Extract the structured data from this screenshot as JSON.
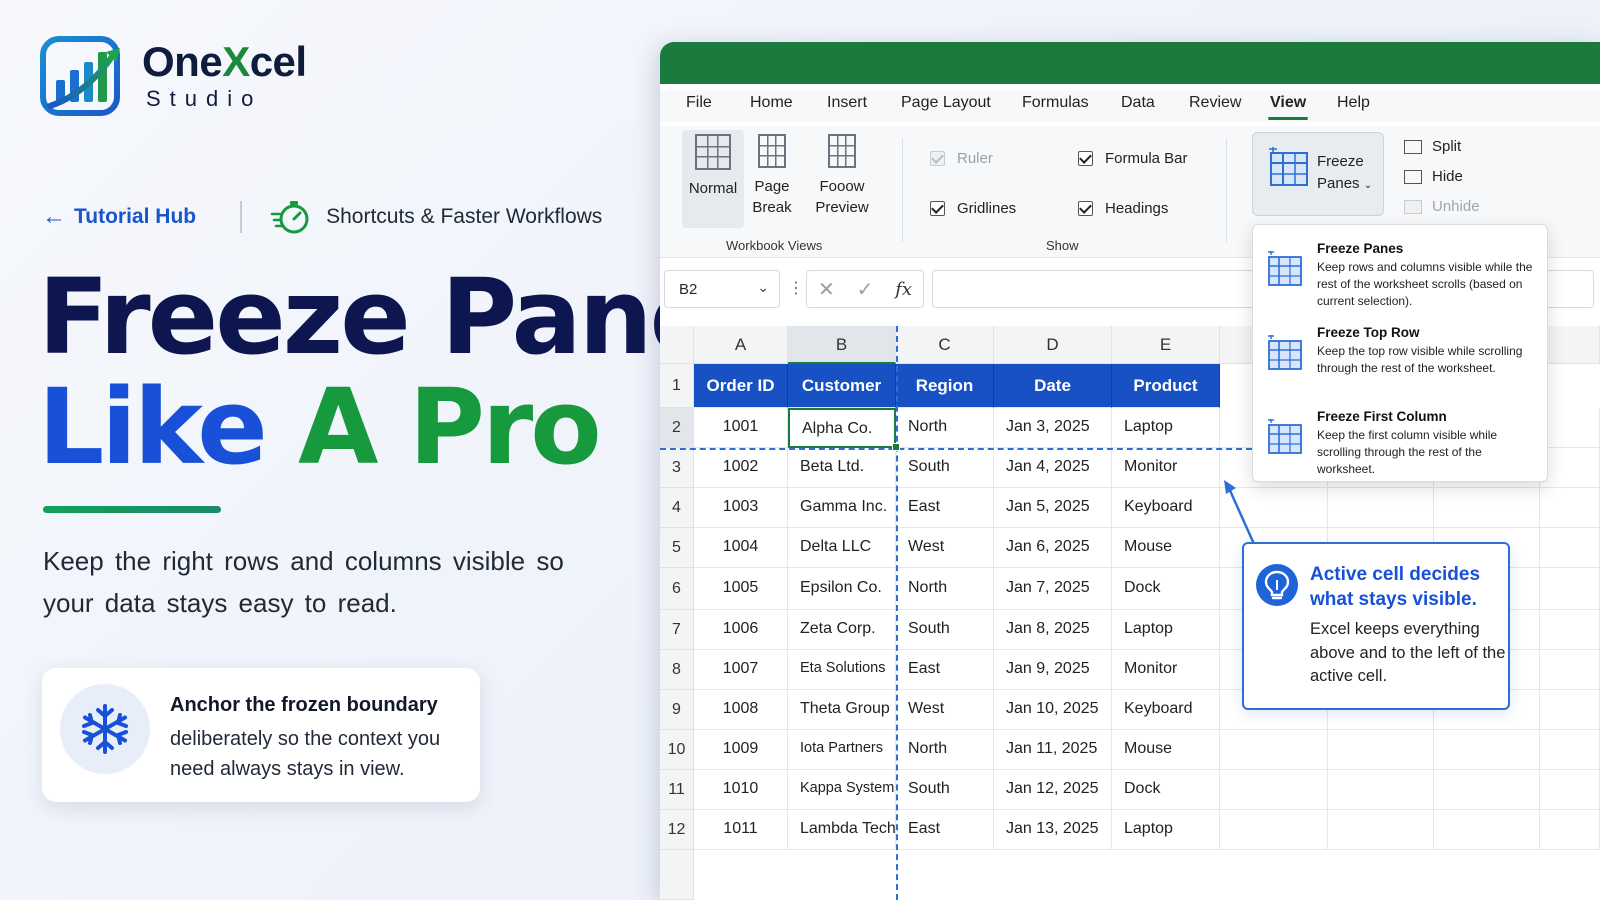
{
  "brand": {
    "name_part1": "One",
    "name_x": "X",
    "name_part2": "cel",
    "sub": "Studio"
  },
  "nav": {
    "back_label": "Tutorial Hub",
    "section": "Shortcuts & Faster Workflows"
  },
  "hero": {
    "line1": "Freeze Panes",
    "line2_a": "Like",
    "line2_b": "A Pro"
  },
  "tagline": "Keep the right rows and columns visible so your data stays easy to read.",
  "tip": {
    "title": "Anchor the frozen boundary",
    "body": "deliberately so the context you need always stays in view."
  },
  "excel": {
    "tabs": [
      "File",
      "Home",
      "Insert",
      "Page Layout",
      "Formulas",
      "Data",
      "Review",
      "View",
      "Help"
    ],
    "active_tab": "View",
    "workbook_views": {
      "normal": "Normal",
      "page_break_1": "Page",
      "page_break_2": "Break",
      "page_layout_1": "Fooow",
      "page_layout_2": "Preview",
      "group_label": "Workbook Views"
    },
    "show": {
      "ruler": "Ruler",
      "gridlines": "Gridlines",
      "formula_bar": "Formula Bar",
      "headings": "Headings",
      "group_label": "Show"
    },
    "freeze_button": {
      "line1": "Freeze",
      "line2": "Panes"
    },
    "window": {
      "split": "Split",
      "hide": "Hide",
      "unhide": "Unhide"
    },
    "name_box": "B2",
    "col_letters": [
      "A",
      "B",
      "C",
      "D",
      "E"
    ],
    "headers": [
      "Order ID",
      "Customer",
      "Region",
      "Date",
      "Product"
    ],
    "rows": [
      [
        "1001",
        "Alpha Co.",
        "North",
        "Jan 3, 2025",
        "Laptop"
      ],
      [
        "1002",
        "Beta Ltd.",
        "South",
        "Jan 4, 2025",
        "Monitor"
      ],
      [
        "1003",
        "Gamma Inc.",
        "East",
        "Jan 5, 2025",
        "Keyboard"
      ],
      [
        "1004",
        "Delta LLC",
        "West",
        "Jan 6, 2025",
        "Mouse"
      ],
      [
        "1005",
        "Epsilon Co.",
        "North",
        "Jan 7, 2025",
        "Dock"
      ],
      [
        "1006",
        "Zeta Corp.",
        "South",
        "Jan 8, 2025",
        "Laptop"
      ],
      [
        "1007",
        "Eta Solutions",
        "East",
        "Jan 9, 2025",
        "Monitor"
      ],
      [
        "1008",
        "Theta Group",
        "West",
        "Jan 10, 2025",
        "Keyboard"
      ],
      [
        "1009",
        "Iota Partners",
        "North",
        "Jan 11, 2025",
        "Mouse"
      ],
      [
        "1010",
        "Kappa Systems",
        "South",
        "Jan 12, 2025",
        "Dock"
      ],
      [
        "1011",
        "Lambda Tech",
        "East",
        "Jan 13, 2025",
        "Laptop"
      ]
    ],
    "menu": [
      {
        "title": "Freeze Panes",
        "desc": "Keep rows and columns visible while the rest of the worksheet scrolls (based on current selection)."
      },
      {
        "title": "Freeze Top Row",
        "desc": "Keep the top row visible while scrolling through the rest of the worksheet."
      },
      {
        "title": "Freeze First Column",
        "desc": "Keep the first column visible while scrolling through the rest of the worksheet."
      }
    ],
    "callout": {
      "title": "Active cell decides what stays visible.",
      "body": "Excel keeps everything above and to the left of the active cell."
    }
  },
  "colors": {
    "excel_green": "#1b7a3e",
    "header_blue": "#1751c4",
    "hero_navy": "#0e1650",
    "hero_blue": "#1851d8",
    "hero_green": "#179a3e",
    "freeze_line": "#2e6fd6"
  }
}
